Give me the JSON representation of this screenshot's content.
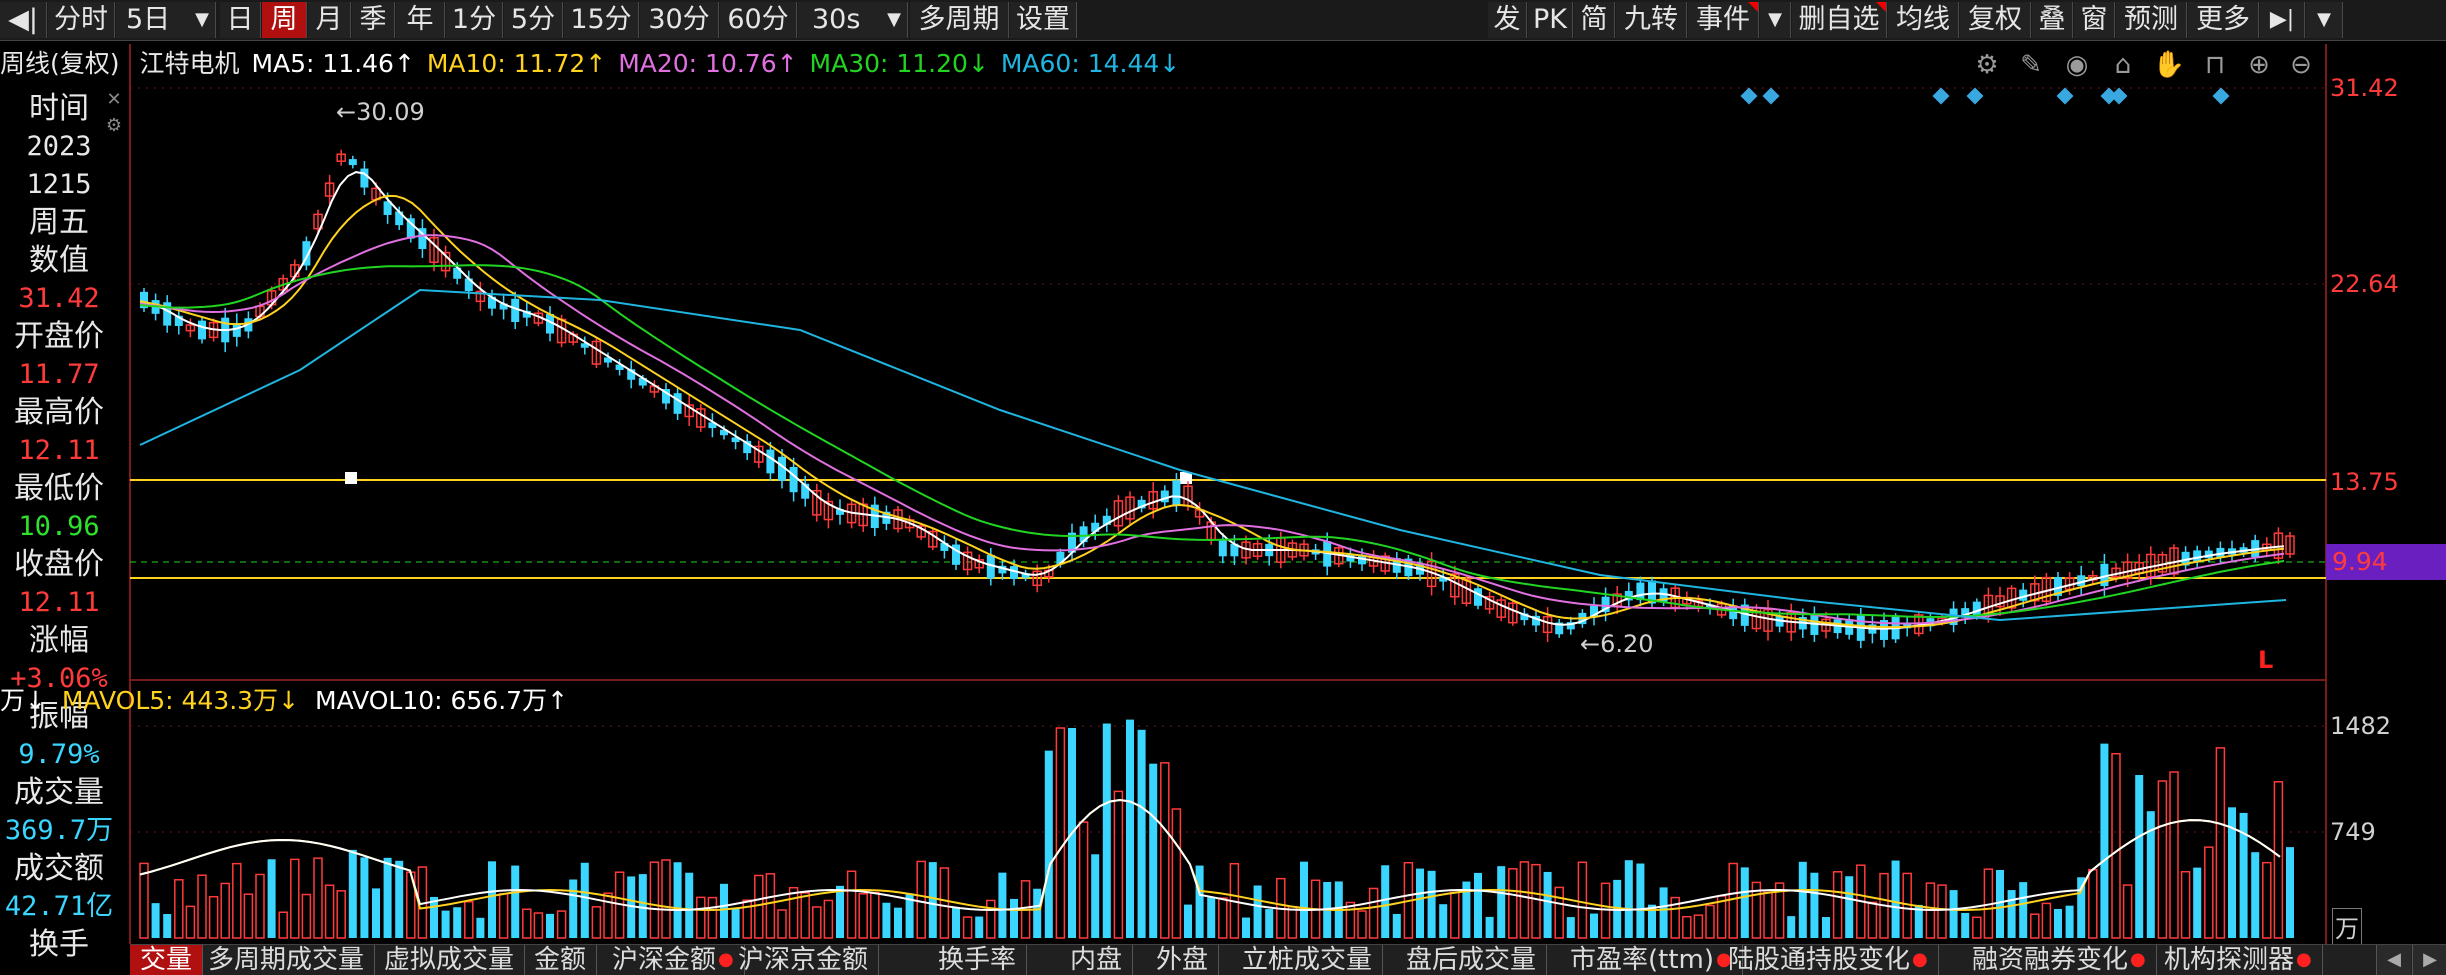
{
  "toolbar_left": [
    {
      "id": "back",
      "label": "◀|"
    },
    {
      "id": "fenshi",
      "label": "分时"
    },
    {
      "id": "5ri",
      "label": "5日"
    },
    {
      "id": "ri",
      "label": "日"
    },
    {
      "id": "zhou",
      "label": "周"
    },
    {
      "id": "yue",
      "label": "月"
    },
    {
      "id": "ji",
      "label": "季"
    },
    {
      "id": "nian",
      "label": "年"
    },
    {
      "id": "1fen",
      "label": "1分"
    },
    {
      "id": "5fen",
      "label": "5分"
    },
    {
      "id": "15fen",
      "label": "15分"
    },
    {
      "id": "30fen",
      "label": "30分"
    },
    {
      "id": "60fen",
      "label": "60分"
    },
    {
      "id": "30s",
      "label": "30s"
    },
    {
      "id": "duozhouqi",
      "label": "多周期"
    },
    {
      "id": "shezhi",
      "label": "设置"
    }
  ],
  "toolbar_right": [
    {
      "id": "fa",
      "label": "发"
    },
    {
      "id": "pk",
      "label": "PK"
    },
    {
      "id": "jian",
      "label": "简"
    },
    {
      "id": "jiuzhuan",
      "label": "九转"
    },
    {
      "id": "shijian",
      "label": "事件"
    },
    {
      "id": "dropdown",
      "label": "▼"
    },
    {
      "id": "shanzixuan",
      "label": "删自选"
    },
    {
      "id": "junxian",
      "label": "均线"
    },
    {
      "id": "fuquan",
      "label": "复权"
    },
    {
      "id": "die",
      "label": "叠"
    },
    {
      "id": "chuang",
      "label": "窗"
    },
    {
      "id": "yuce",
      "label": "预测"
    },
    {
      "id": "gengduo",
      "label": "更多"
    },
    {
      "id": "collapse",
      "label": "▶|"
    },
    {
      "id": "menu",
      "label": "▼"
    }
  ],
  "info": {
    "period": "周线(复权)",
    "stock": "江特电机",
    "ma5": "MA5: 11.46↑",
    "ma10": "MA10: 11.72↑",
    "ma20": "MA20: 10.76↑",
    "ma30": "MA30: 11.20↓",
    "ma60": "MA60: 14.44↓"
  },
  "tool_icons": [
    "gear-icon",
    "pen-icon",
    "eye-icon",
    "building-icon",
    "hand-icon",
    "lock-icon",
    "zoom-in-icon",
    "zoom-out-icon"
  ],
  "left_panel": {
    "time_label": "时间",
    "year": "2023",
    "date": "1215",
    "weekday": "周五",
    "value_label": "数值",
    "value": "31.42",
    "open_label": "开盘价",
    "open": "11.77",
    "high_label": "最高价",
    "high": "12.11",
    "low_label": "最低价",
    "low": "10.96",
    "close_label": "收盘价",
    "close": "12.11",
    "change_label": "涨幅",
    "change": "+3.06%",
    "amplitude_label": "振幅",
    "amplitude": "9.79%",
    "volume_label": "成交量",
    "volume": "369.7万",
    "amount_label": "成交额",
    "amount": "42.71亿",
    "turnover_label": "换手"
  },
  "price_axis": [
    "31.42",
    "22.64",
    "13.75",
    "9.94"
  ],
  "volume_axis": [
    "1482",
    "749",
    "万"
  ],
  "annotations": {
    "high": "30.09",
    "low": "6.20",
    "marker": "L"
  },
  "volume_info": {
    "vol_unit": "万↓",
    "mavol5": "MAVOL5: 443.3万↓",
    "mavol10": "MAVOL10: 656.7万↑"
  },
  "bottom_tabs": [
    {
      "id": "vol",
      "label": "交量"
    },
    {
      "id": "duozhouqichengjiao",
      "label": "多周期成交量"
    },
    {
      "id": "xuni",
      "label": "虚拟成交量"
    },
    {
      "id": "jine",
      "label": "金额"
    },
    {
      "id": "hushenjine",
      "label": "沪深金额"
    },
    {
      "id": "hushenjingjine",
      "label": "沪深京金额"
    },
    {
      "id": "huanshou",
      "label": "换手率"
    },
    {
      "id": "neipan",
      "label": "内盘"
    },
    {
      "id": "waipan",
      "label": "外盘"
    },
    {
      "id": "lizhuang",
      "label": "立桩成交量"
    },
    {
      "id": "panhou",
      "label": "盘后成交量"
    },
    {
      "id": "shiyinglv",
      "label": "市盈率(ttm)"
    },
    {
      "id": "lugutong",
      "label": "陆股通持股变化"
    },
    {
      "id": "rongzi",
      "label": "融资融券变化"
    },
    {
      "id": "jigou",
      "label": "机构探测器"
    }
  ],
  "colors": {
    "up": "#ff3a3a",
    "down": "#3ad6ff",
    "ma5": "#ffffff",
    "ma10": "#ffd21e",
    "ma20": "#e070e0",
    "ma30": "#21d421",
    "ma60": "#1fb5e0",
    "active": "#b01010"
  }
}
